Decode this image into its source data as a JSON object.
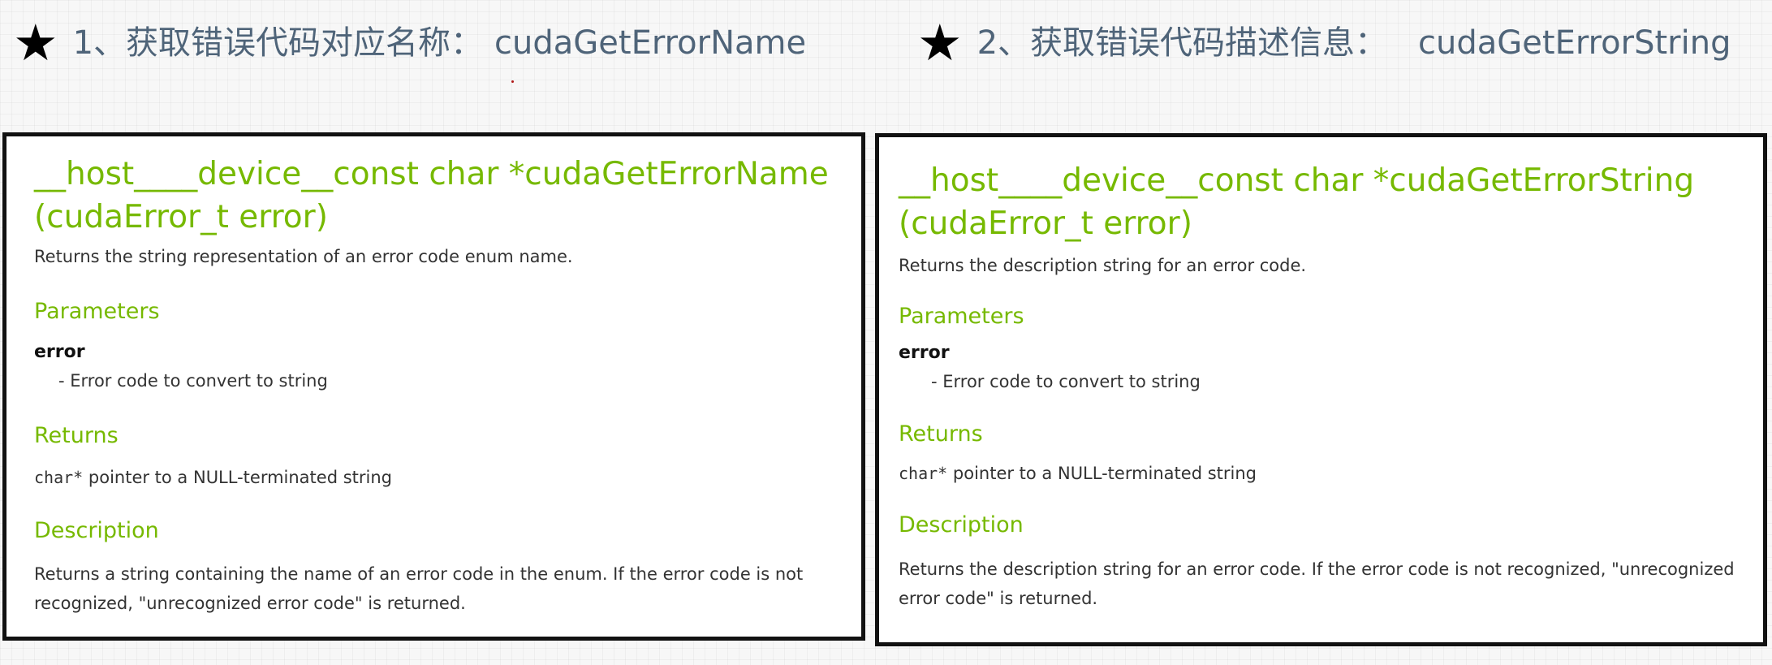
{
  "headings": [
    {
      "star": "★",
      "text": "1、获取错误代码对应名称：",
      "function": "cudaGetErrorName"
    },
    {
      "star": "★",
      "text": "2、获取错误代码描述信息：",
      "function": "cudaGetErrorString"
    }
  ],
  "panels": [
    {
      "signature": "__host____device__const char *cudaGetErrorName (cudaError_t error)",
      "summary": "Returns the string representation of an error code enum name.",
      "parameters_heading": "Parameters",
      "param_name": "error",
      "param_detail": "- Error code to convert to string",
      "returns_heading": "Returns",
      "return_code": "char*",
      "return_text": " pointer to a NULL-terminated string",
      "description_heading": "Description",
      "description": "Returns a string containing the name of an error code in the enum. If the error code is not recognized, \"unrecognized error code\" is returned."
    },
    {
      "signature": "__host____device__const char *cudaGetErrorString (cudaError_t error)",
      "summary": "Returns the description string for an error code.",
      "parameters_heading": "Parameters",
      "param_name": "error",
      "param_detail": "- Error code to convert to string",
      "returns_heading": "Returns",
      "return_code": "char*",
      "return_text": " pointer to a NULL-terminated string",
      "description_heading": "Description",
      "description": "Returns the description string for an error code. If the error code is not recognized, \"unrecognized error code\" is returned."
    }
  ],
  "colors": {
    "heading_text": "#4f6479",
    "nvidia_green": "#76b900",
    "body_text": "#333333",
    "panel_border": "#111111"
  }
}
